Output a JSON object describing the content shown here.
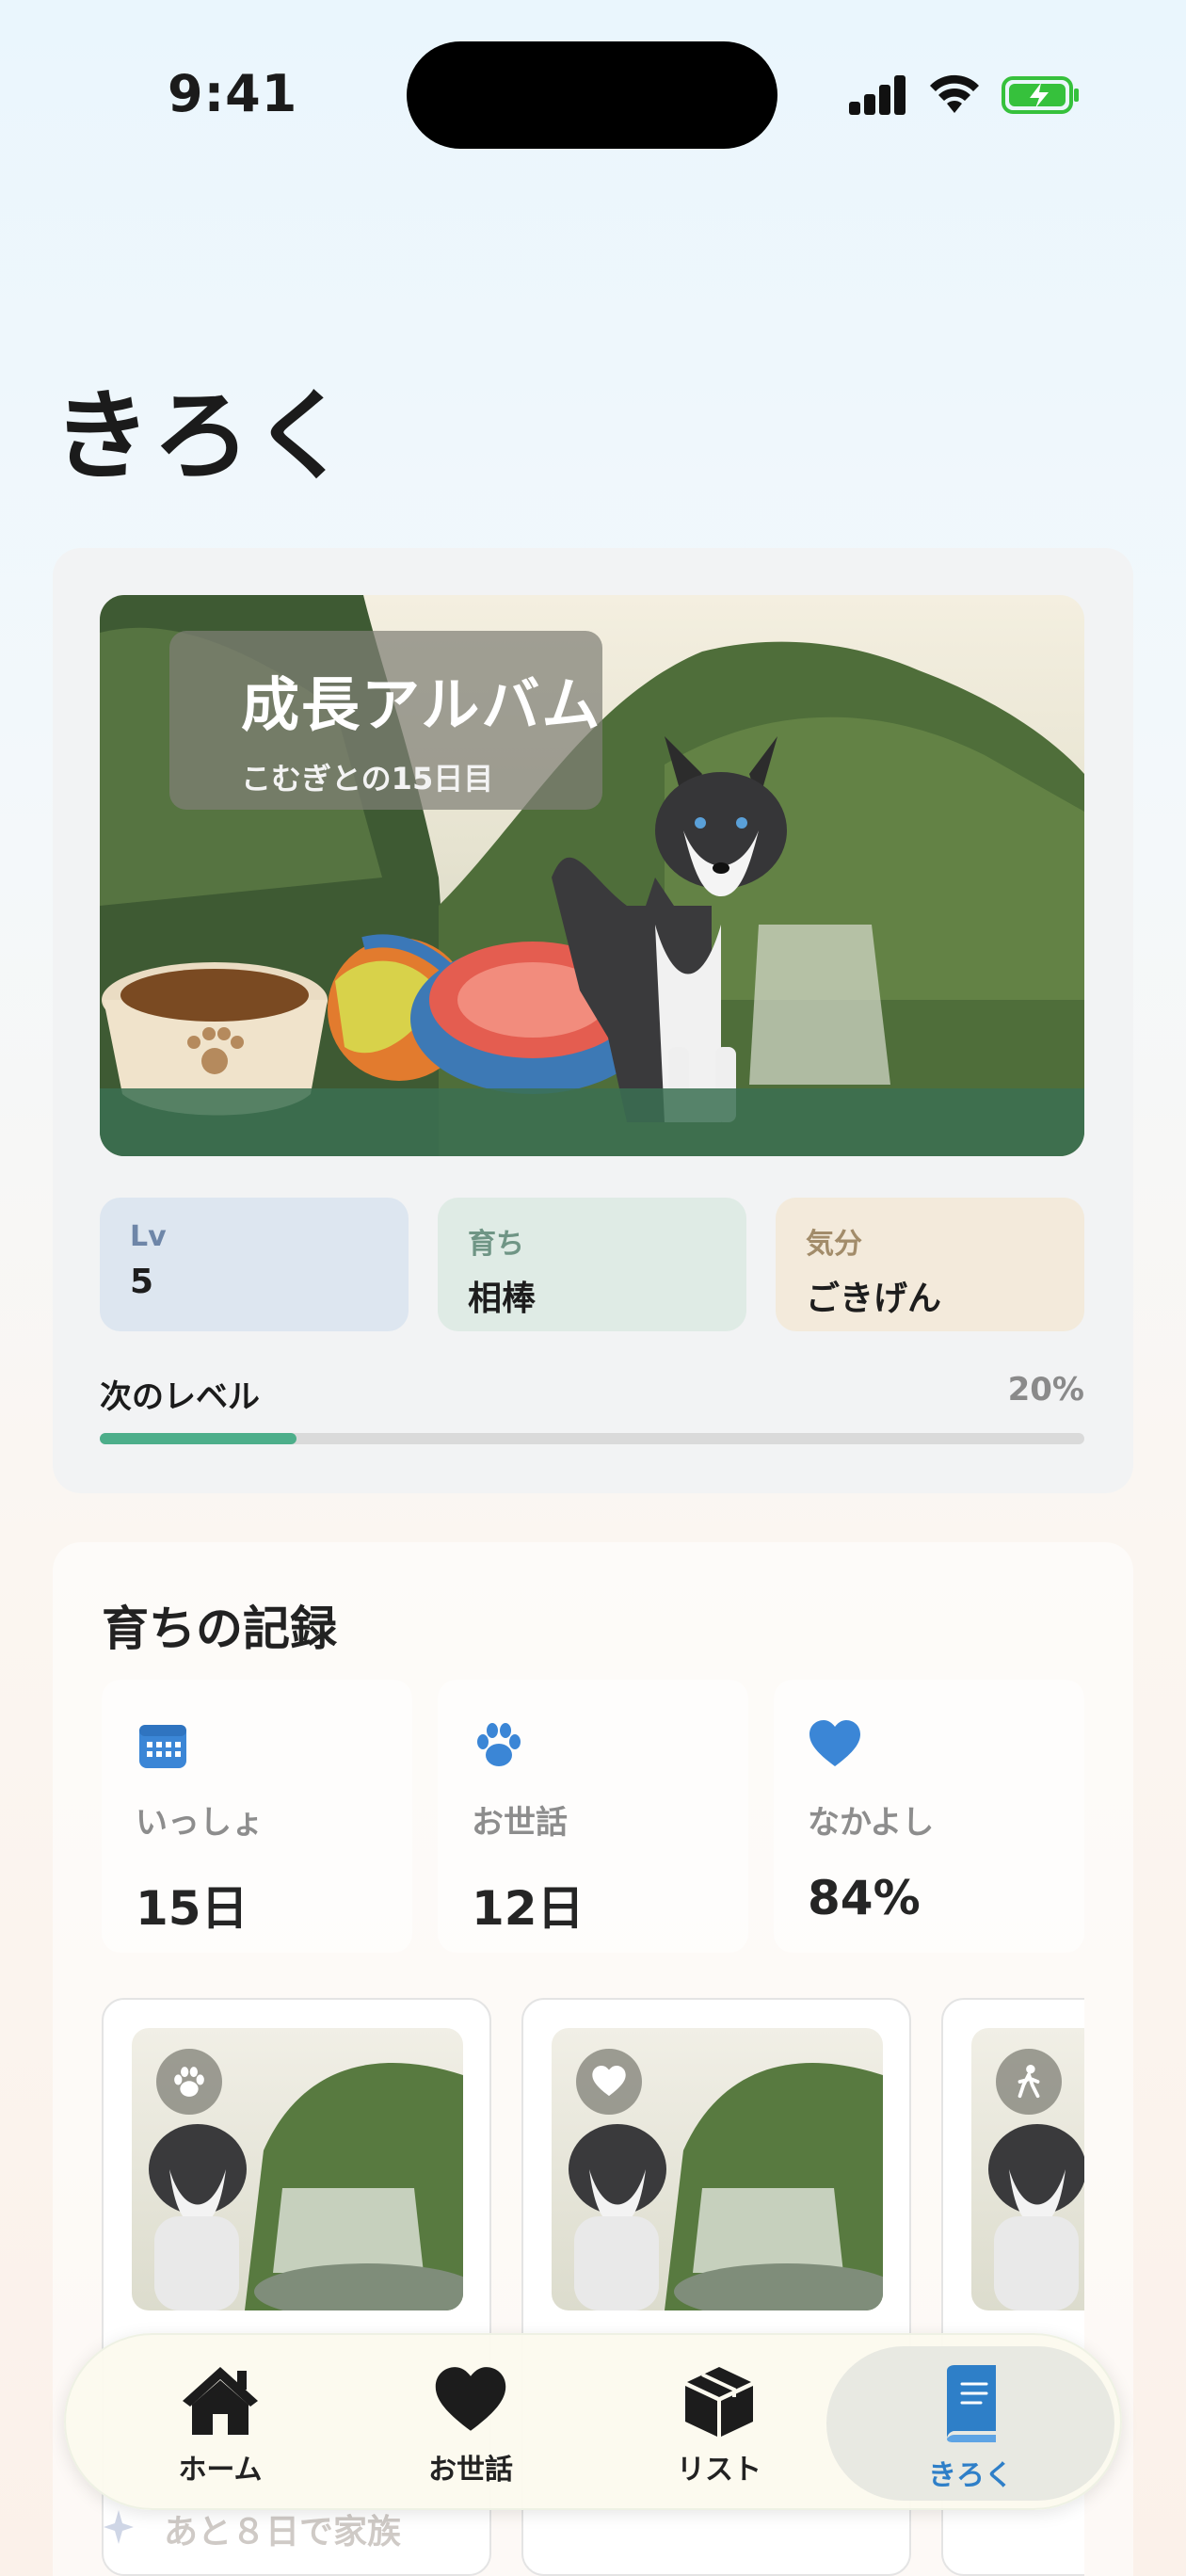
{
  "status_bar": {
    "time": "9:41"
  },
  "page": {
    "title": "きろく"
  },
  "album": {
    "title": "成長アルバム",
    "subtitle": "こむぎとの15日目",
    "chips": [
      {
        "label": "Lv",
        "value": "5",
        "bg": "#dde6f0",
        "label_color": "#6e86a8"
      },
      {
        "label": "育ち",
        "value": "相棒",
        "bg": "#dfebe5",
        "label_color": "#6f9585"
      },
      {
        "label": "気分",
        "value": "ごきげん",
        "bg": "#f3eadb",
        "label_color": "#a28c6a"
      }
    ],
    "level": {
      "label": "次のレベル",
      "percent_text": "20%",
      "progress": 0.2
    }
  },
  "records": {
    "title": "育ちの記録",
    "metrics": [
      {
        "icon": "calendar-icon",
        "label": "いっしょ",
        "value": "15日"
      },
      {
        "icon": "paw-icon",
        "label": "お世話",
        "value": "12日"
      },
      {
        "icon": "heart-icon",
        "label": "なかよし",
        "value": "84%"
      }
    ],
    "thumb_badges": [
      "paw-icon",
      "heart-icon",
      "walk-icon"
    ]
  },
  "hint": {
    "text": "あと８日で家族"
  },
  "tabs": [
    {
      "icon": "house-icon",
      "label": "ホーム"
    },
    {
      "icon": "heart-icon",
      "label": "お世話"
    },
    {
      "icon": "box-icon",
      "label": "リスト"
    },
    {
      "icon": "book-icon",
      "label": "きろく",
      "active": true
    }
  ],
  "colors": {
    "accent_blue": "#2e7fc8",
    "progress_green": "#4dae8a"
  }
}
